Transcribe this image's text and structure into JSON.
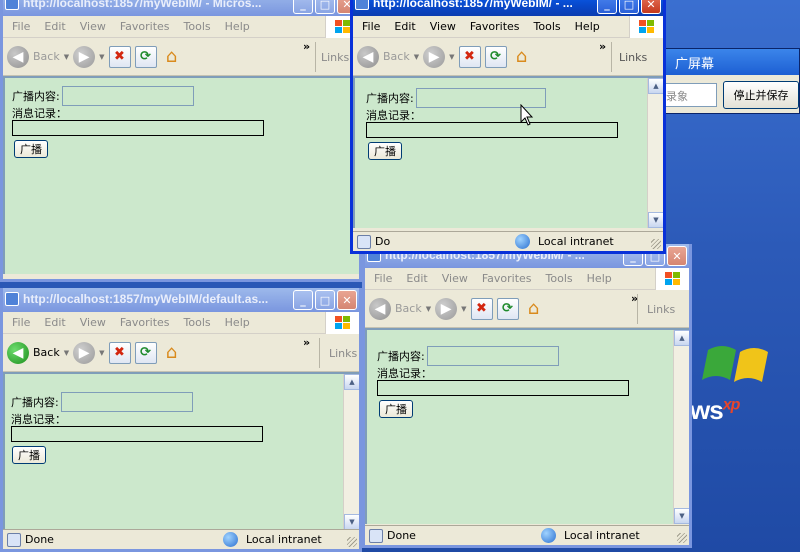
{
  "desktop": {
    "logo_text": "ws",
    "logo_suffix": "xp",
    "recorder": {
      "title": "广屏幕",
      "field_text": "录象",
      "stop_save_label": "停止并保存"
    }
  },
  "menu": [
    "File",
    "Edit",
    "View",
    "Favorites",
    "Tools",
    "Help"
  ],
  "toolbar": {
    "back_label": "Back",
    "links_label": "Links",
    "chevron": "»"
  },
  "form": {
    "broadcast_label": "广播内容:",
    "log_label": "消息记录：",
    "button_label": "广播"
  },
  "windows": {
    "top_left": {
      "title": "http://localhost:1857/myWebIM/ - Micros...",
      "status": ""
    },
    "bottom_left": {
      "title": "http://localhost:1857/myWebIM/default.as...",
      "status": "Done",
      "zone": "Local intranet"
    },
    "active": {
      "title": "http://localhost:1857/myWebIM/ - ...",
      "status": "Do",
      "zone": "Local intranet"
    },
    "bottom_right": {
      "title": "http://localhost:1857/myWebIM/ - ...",
      "status": "Done",
      "zone": "Local intranet"
    }
  }
}
